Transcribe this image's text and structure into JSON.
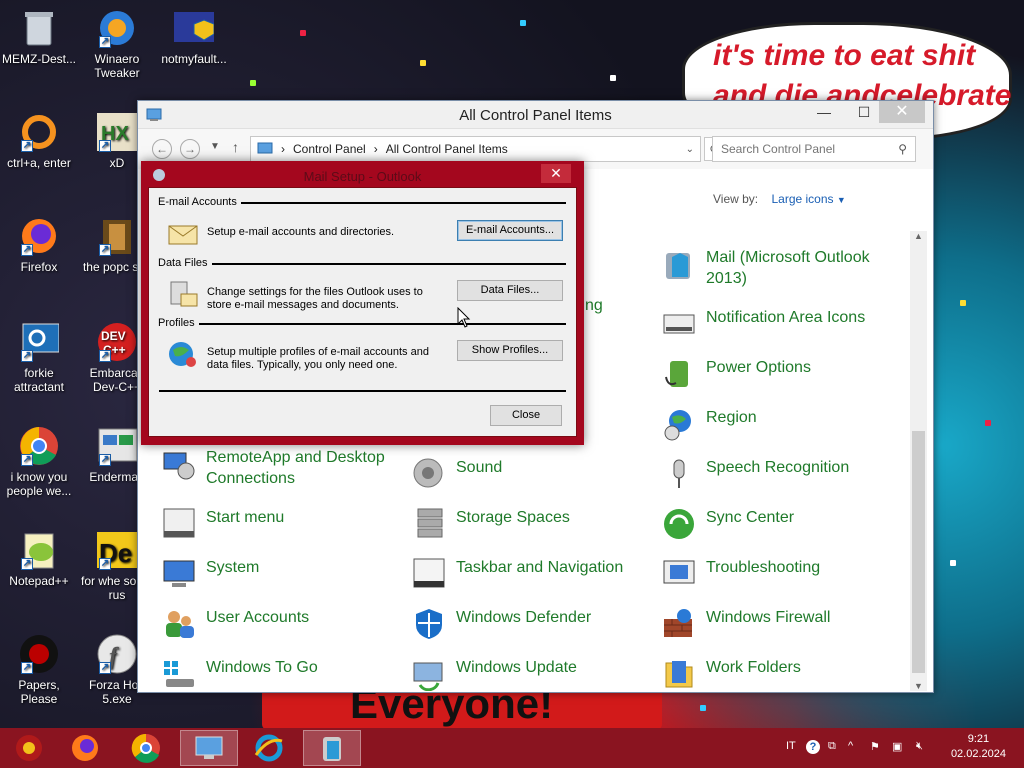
{
  "desktop": {
    "icons": [
      {
        "label": "MEMZ-Dest...",
        "icon": "recycle-bin-icon"
      },
      {
        "label": "Winaero Tweaker",
        "icon": "winaero-icon"
      },
      {
        "label": "notmyfault...",
        "icon": "notmyfault-icon"
      },
      {
        "label": "ctrl+a, enter",
        "icon": "orange-ring-icon"
      },
      {
        "label": "xD",
        "icon": "xd-icon"
      },
      {
        "label": "Firefox",
        "icon": "firefox-icon"
      },
      {
        "label": "the popc shit",
        "icon": "popcorn-icon"
      },
      {
        "label": "forkie attractant",
        "icon": "monitor-gear-icon"
      },
      {
        "label": "Embarcad Dev-C++",
        "icon": "devcpp-icon"
      },
      {
        "label": "i know you people we...",
        "icon": "chrome-icon"
      },
      {
        "label": "Enderman",
        "icon": "enderman-icon"
      },
      {
        "label": "Notepad++",
        "icon": "notepadpp-icon"
      },
      {
        "label": "for whe some rus",
        "icon": "photo-icon"
      },
      {
        "label": "Papers, Please",
        "icon": "papers-please-icon"
      },
      {
        "label": "Forza Hori 5.exe",
        "icon": "flash-icon"
      }
    ],
    "bubble_line1": "it's time to eat shit",
    "bubble_line2": "and die andcelebrate",
    "poster_text": "Everyone!"
  },
  "control_panel": {
    "title": "All Control Panel Items",
    "breadcrumb": [
      "Control Panel",
      "All Control Panel Items"
    ],
    "search_placeholder": "Search Control Panel",
    "view_by_label": "View by:",
    "view_by_value": "Large icons",
    "partial_text": "ng",
    "items": [
      {
        "label": "Mail (Microsoft Outlook 2013)",
        "icon": "mail-icon"
      },
      {
        "label": "Notification Area Icons",
        "icon": "notification-area-icon"
      },
      {
        "label": "Power Options",
        "icon": "power-options-icon"
      },
      {
        "label": "Region",
        "icon": "region-icon"
      },
      {
        "label": "RemoteApp and Desktop Connections",
        "icon": "remoteapp-icon"
      },
      {
        "label": "Sound",
        "icon": "sound-icon"
      },
      {
        "label": "Speech Recognition",
        "icon": "microphone-icon"
      },
      {
        "label": "Start menu",
        "icon": "start-menu-icon"
      },
      {
        "label": "Storage Spaces",
        "icon": "storage-spaces-icon"
      },
      {
        "label": "Sync Center",
        "icon": "sync-center-icon"
      },
      {
        "label": "System",
        "icon": "system-icon"
      },
      {
        "label": "Taskbar and Navigation",
        "icon": "taskbar-icon"
      },
      {
        "label": "Troubleshooting",
        "icon": "troubleshooting-icon"
      },
      {
        "label": "User Accounts",
        "icon": "user-accounts-icon"
      },
      {
        "label": "Windows Defender",
        "icon": "shield-icon"
      },
      {
        "label": "Windows Firewall",
        "icon": "firewall-icon"
      },
      {
        "label": "Windows To Go",
        "icon": "windows-to-go-icon"
      },
      {
        "label": "Windows Update",
        "icon": "windows-update-icon"
      },
      {
        "label": "Work Folders",
        "icon": "work-folders-icon"
      }
    ]
  },
  "mail_dialog": {
    "title": "Mail Setup - Outlook",
    "email_section": "E-mail Accounts",
    "email_desc": "Setup e-mail accounts and directories.",
    "email_button": "E-mail Accounts...",
    "data_section": "Data Files",
    "data_desc_1": "Change settings for the files Outlook uses to",
    "data_desc_2": "store e-mail messages and documents.",
    "data_button": "Data Files...",
    "profiles_section": "Profiles",
    "profiles_desc_1": "Setup multiple profiles of e-mail accounts and",
    "profiles_desc_2": "data files. Typically, you only need one.",
    "profiles_button": "Show Profiles...",
    "close_button": "Close"
  },
  "taskbar": {
    "language": "IT",
    "time": "9:21",
    "date": "02.02.2024"
  },
  "colors": {
    "taskbar": "#8a1420",
    "dialog_frame": "#a4071e",
    "item_label": "#1f7a2a",
    "link": "#1a5fb4"
  }
}
